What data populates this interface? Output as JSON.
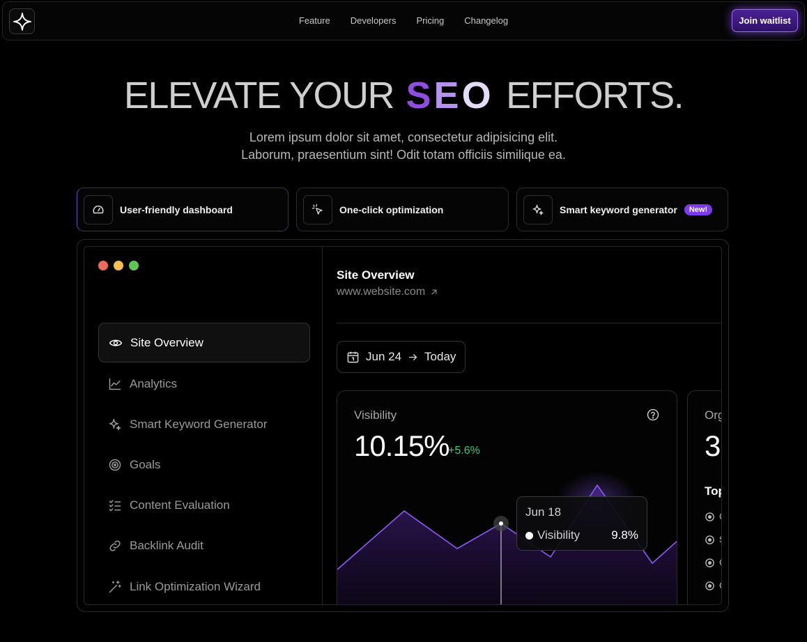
{
  "nav": {
    "links": [
      "Feature",
      "Developers",
      "Pricing",
      "Changelog"
    ],
    "cta_label": "Join waitlist"
  },
  "hero": {
    "title_start": "ELEVATE YOUR",
    "title_highlight": [
      "S",
      "E",
      "O"
    ],
    "title_end": "EFFORTS.",
    "subtitle_line1": "Lorem ipsum dolor sit amet, consectetur adipisicing elit.",
    "subtitle_line2": "Laborum, praesentium sint! Odit totam officiis similique ea."
  },
  "features": [
    {
      "label": "User-friendly dashboard",
      "icon": "gauge-icon",
      "active": true
    },
    {
      "label": "One-click optimization",
      "icon": "cursor-click-icon",
      "active": false
    },
    {
      "label": "Smart keyword generator",
      "icon": "sparkles-icon",
      "active": false,
      "badge": "New!"
    }
  ],
  "window_dots": {
    "red": "#ed6a5e",
    "yellow": "#f4bf4f",
    "green": "#61c554"
  },
  "sidebar": {
    "items": [
      {
        "label": "Site Overview",
        "icon": "eye-icon",
        "active": true
      },
      {
        "label": "Analytics",
        "icon": "line-chart-icon"
      },
      {
        "label": "Smart Keyword Generator",
        "icon": "sparkles-icon"
      },
      {
        "label": "Goals",
        "icon": "target-icon"
      },
      {
        "label": "Content Evaluation",
        "icon": "list-check-icon"
      },
      {
        "label": "Backlink Audit",
        "icon": "link-icon"
      },
      {
        "label": "Link Optimization Wizard",
        "icon": "magic-wand-icon"
      }
    ]
  },
  "overview": {
    "title": "Site Overview",
    "url": "www.website.com",
    "date_from": "Jun 24",
    "date_to": "Today"
  },
  "visibility": {
    "label": "Visibility",
    "value": "10.15%",
    "delta": "+5.6%",
    "tooltip": {
      "date": "Jun 18",
      "series": "Visibility",
      "value": "9.8%"
    }
  },
  "organic": {
    "label_partial": "Org",
    "value_partial": "3",
    "top_partial": "Top",
    "row_initials": [
      "c",
      "s",
      "c",
      "c"
    ]
  },
  "colors": {
    "accent": "#8b5cf6",
    "positive": "#2fd07a"
  }
}
